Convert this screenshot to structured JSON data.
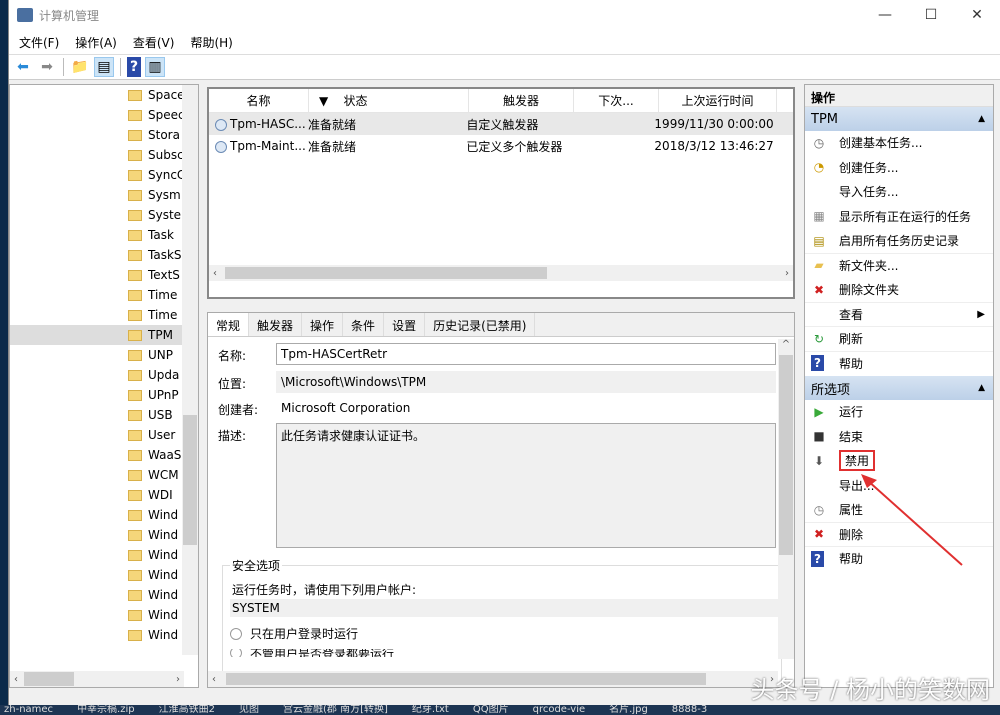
{
  "window": {
    "title": "计算机管理",
    "controls": [
      "—",
      "☐",
      "✕"
    ]
  },
  "menu": [
    "文件(F)",
    "操作(A)",
    "查看(V)",
    "帮助(H)"
  ],
  "tree": {
    "items": [
      "Space",
      "Speec",
      "Stora",
      "Subsc",
      "SyncC",
      "Sysm",
      "Syste",
      "Task",
      "TaskS",
      "TextS",
      "Time",
      "Time",
      "TPM",
      "UNP",
      "Upda",
      "UPnP",
      "USB",
      "User",
      "WaaS",
      "WCM",
      "WDI",
      "Wind",
      "Wind",
      "Wind",
      "Wind",
      "Wind",
      "Wind",
      "Wind"
    ],
    "selected": "TPM"
  },
  "tasks": {
    "columns": [
      "名称",
      "状态",
      "触发器",
      "下次...",
      "上次运行时间"
    ],
    "rows": [
      {
        "name": "Tpm-HASC...",
        "status": "准备就绪",
        "trigger": "自定义触发器",
        "next": "",
        "last": "1999/11/30 0:00:00"
      },
      {
        "name": "Tpm-Maint...",
        "status": "准备就绪",
        "trigger": "已定义多个触发器",
        "next": "",
        "last": "2018/3/12 13:46:27"
      }
    ]
  },
  "detail": {
    "tabs": [
      "常规",
      "触发器",
      "操作",
      "条件",
      "设置",
      "历史记录(已禁用)"
    ],
    "name_label": "名称:",
    "name": "Tpm-HASCertRetr",
    "location_label": "位置:",
    "location": "\\Microsoft\\Windows\\TPM",
    "author_label": "创建者:",
    "author": "Microsoft Corporation",
    "desc_label": "描述:",
    "desc": "此任务请求健康认证证书。",
    "security_title": "安全选项",
    "run_as_label": "运行任务时，请使用下列用户帐户:",
    "run_as": "SYSTEM",
    "opt1": "只在用户登录时运行",
    "opt2": "不管用户是否登录都要运行"
  },
  "actions": {
    "header": "操作",
    "section1": "TPM",
    "items1": [
      {
        "label": "创建基本任务...",
        "icon": "create-basic-task-icon"
      },
      {
        "label": "创建任务...",
        "icon": "create-task-icon"
      },
      {
        "label": "导入任务...",
        "icon": ""
      },
      {
        "label": "显示所有正在运行的任务",
        "icon": "running-tasks-icon"
      },
      {
        "label": "启用所有任务历史记录",
        "icon": "history-icon"
      },
      {
        "label": "新文件夹...",
        "icon": "folder-icon"
      },
      {
        "label": "删除文件夹",
        "icon": "delete-icon"
      },
      {
        "label": "查看",
        "icon": ""
      },
      {
        "label": "刷新",
        "icon": "refresh-icon"
      },
      {
        "label": "帮助",
        "icon": "help-icon"
      }
    ],
    "section2": "所选项",
    "items2": [
      {
        "label": "运行",
        "icon": "run-icon"
      },
      {
        "label": "结束",
        "icon": "stop-icon"
      },
      {
        "label": "禁用",
        "icon": "disable-icon"
      },
      {
        "label": "导出...",
        "icon": ""
      },
      {
        "label": "属性",
        "icon": "properties-icon"
      },
      {
        "label": "删除",
        "icon": "delete-icon"
      },
      {
        "label": "帮助",
        "icon": "help-icon"
      }
    ],
    "highlight_color": "#e03030"
  },
  "taskbar": [
    "zh-namec",
    "中莘宗稿.zip",
    "江淮高铁曲2",
    "见图",
    "宫云金融(郡 南方[转换]",
    "纪芽.txt",
    "QQ图片",
    "qrcode-vie",
    "名片.jpg",
    "8888-3"
  ],
  "watermark": "头条号 / 杨小的笑数网"
}
